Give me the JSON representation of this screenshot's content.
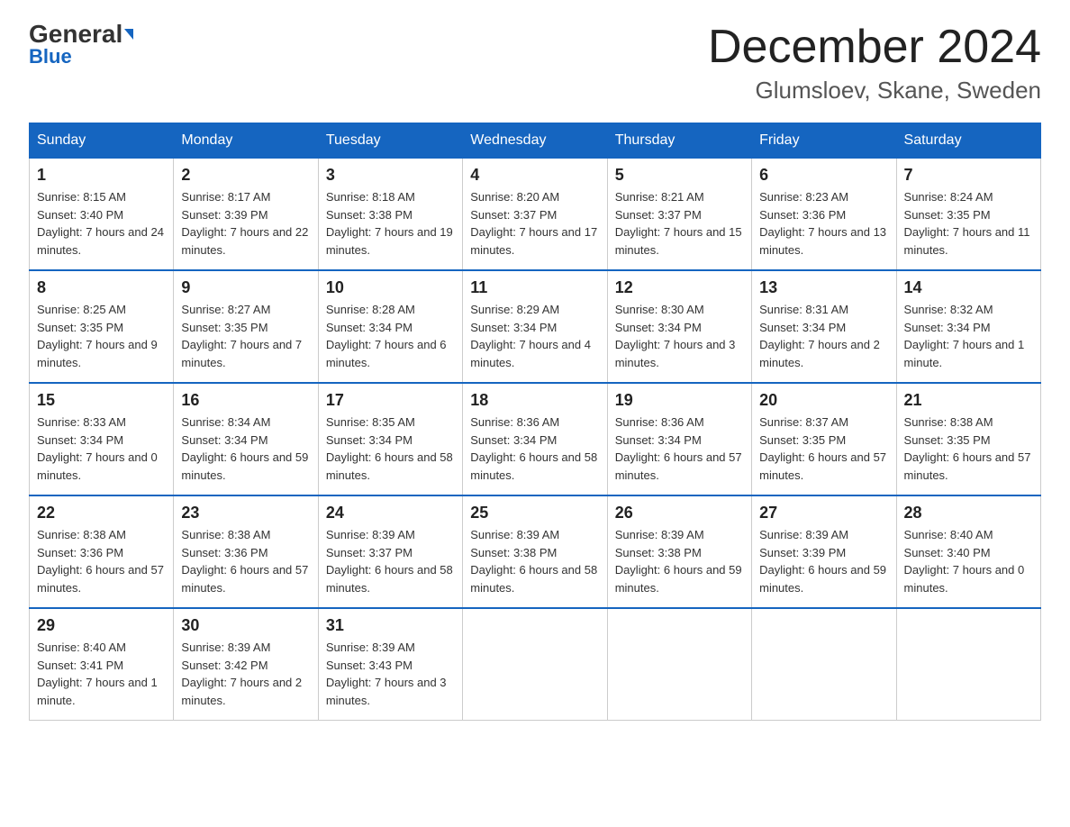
{
  "header": {
    "logo_general": "General",
    "logo_blue": "Blue",
    "title": "December 2024",
    "subtitle": "Glumsloev, Skane, Sweden"
  },
  "days_of_week": [
    "Sunday",
    "Monday",
    "Tuesday",
    "Wednesday",
    "Thursday",
    "Friday",
    "Saturday"
  ],
  "weeks": [
    [
      {
        "day": "1",
        "sunrise": "8:15 AM",
        "sunset": "3:40 PM",
        "daylight": "7 hours and 24 minutes."
      },
      {
        "day": "2",
        "sunrise": "8:17 AM",
        "sunset": "3:39 PM",
        "daylight": "7 hours and 22 minutes."
      },
      {
        "day": "3",
        "sunrise": "8:18 AM",
        "sunset": "3:38 PM",
        "daylight": "7 hours and 19 minutes."
      },
      {
        "day": "4",
        "sunrise": "8:20 AM",
        "sunset": "3:37 PM",
        "daylight": "7 hours and 17 minutes."
      },
      {
        "day": "5",
        "sunrise": "8:21 AM",
        "sunset": "3:37 PM",
        "daylight": "7 hours and 15 minutes."
      },
      {
        "day": "6",
        "sunrise": "8:23 AM",
        "sunset": "3:36 PM",
        "daylight": "7 hours and 13 minutes."
      },
      {
        "day": "7",
        "sunrise": "8:24 AM",
        "sunset": "3:35 PM",
        "daylight": "7 hours and 11 minutes."
      }
    ],
    [
      {
        "day": "8",
        "sunrise": "8:25 AM",
        "sunset": "3:35 PM",
        "daylight": "7 hours and 9 minutes."
      },
      {
        "day": "9",
        "sunrise": "8:27 AM",
        "sunset": "3:35 PM",
        "daylight": "7 hours and 7 minutes."
      },
      {
        "day": "10",
        "sunrise": "8:28 AM",
        "sunset": "3:34 PM",
        "daylight": "7 hours and 6 minutes."
      },
      {
        "day": "11",
        "sunrise": "8:29 AM",
        "sunset": "3:34 PM",
        "daylight": "7 hours and 4 minutes."
      },
      {
        "day": "12",
        "sunrise": "8:30 AM",
        "sunset": "3:34 PM",
        "daylight": "7 hours and 3 minutes."
      },
      {
        "day": "13",
        "sunrise": "8:31 AM",
        "sunset": "3:34 PM",
        "daylight": "7 hours and 2 minutes."
      },
      {
        "day": "14",
        "sunrise": "8:32 AM",
        "sunset": "3:34 PM",
        "daylight": "7 hours and 1 minute."
      }
    ],
    [
      {
        "day": "15",
        "sunrise": "8:33 AM",
        "sunset": "3:34 PM",
        "daylight": "7 hours and 0 minutes."
      },
      {
        "day": "16",
        "sunrise": "8:34 AM",
        "sunset": "3:34 PM",
        "daylight": "6 hours and 59 minutes."
      },
      {
        "day": "17",
        "sunrise": "8:35 AM",
        "sunset": "3:34 PM",
        "daylight": "6 hours and 58 minutes."
      },
      {
        "day": "18",
        "sunrise": "8:36 AM",
        "sunset": "3:34 PM",
        "daylight": "6 hours and 58 minutes."
      },
      {
        "day": "19",
        "sunrise": "8:36 AM",
        "sunset": "3:34 PM",
        "daylight": "6 hours and 57 minutes."
      },
      {
        "day": "20",
        "sunrise": "8:37 AM",
        "sunset": "3:35 PM",
        "daylight": "6 hours and 57 minutes."
      },
      {
        "day": "21",
        "sunrise": "8:38 AM",
        "sunset": "3:35 PM",
        "daylight": "6 hours and 57 minutes."
      }
    ],
    [
      {
        "day": "22",
        "sunrise": "8:38 AM",
        "sunset": "3:36 PM",
        "daylight": "6 hours and 57 minutes."
      },
      {
        "day": "23",
        "sunrise": "8:38 AM",
        "sunset": "3:36 PM",
        "daylight": "6 hours and 57 minutes."
      },
      {
        "day": "24",
        "sunrise": "8:39 AM",
        "sunset": "3:37 PM",
        "daylight": "6 hours and 58 minutes."
      },
      {
        "day": "25",
        "sunrise": "8:39 AM",
        "sunset": "3:38 PM",
        "daylight": "6 hours and 58 minutes."
      },
      {
        "day": "26",
        "sunrise": "8:39 AM",
        "sunset": "3:38 PM",
        "daylight": "6 hours and 59 minutes."
      },
      {
        "day": "27",
        "sunrise": "8:39 AM",
        "sunset": "3:39 PM",
        "daylight": "6 hours and 59 minutes."
      },
      {
        "day": "28",
        "sunrise": "8:40 AM",
        "sunset": "3:40 PM",
        "daylight": "7 hours and 0 minutes."
      }
    ],
    [
      {
        "day": "29",
        "sunrise": "8:40 AM",
        "sunset": "3:41 PM",
        "daylight": "7 hours and 1 minute."
      },
      {
        "day": "30",
        "sunrise": "8:39 AM",
        "sunset": "3:42 PM",
        "daylight": "7 hours and 2 minutes."
      },
      {
        "day": "31",
        "sunrise": "8:39 AM",
        "sunset": "3:43 PM",
        "daylight": "7 hours and 3 minutes."
      },
      null,
      null,
      null,
      null
    ]
  ]
}
